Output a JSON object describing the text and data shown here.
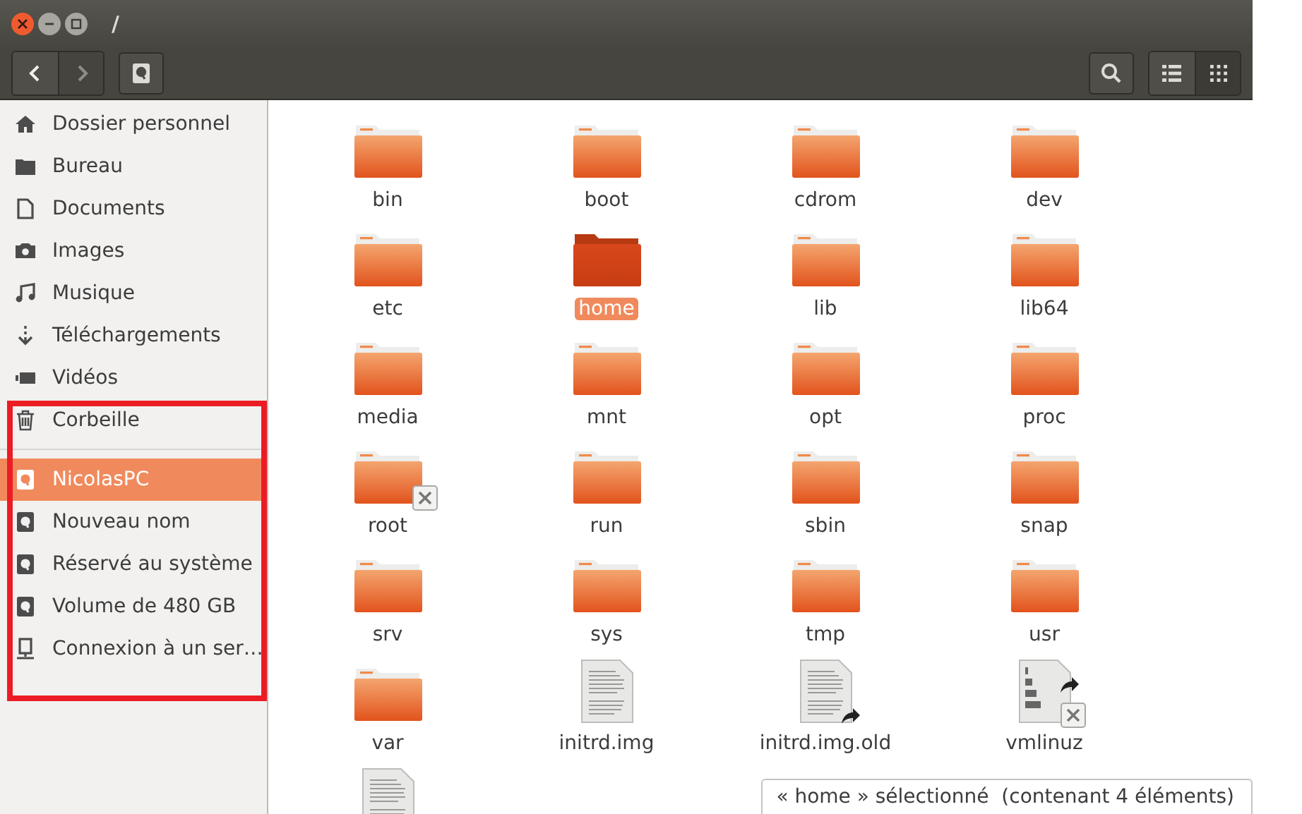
{
  "window": {
    "title": "/"
  },
  "toolbar": {
    "back_disabled": false,
    "forward_disabled": true,
    "view_buttons": [
      {
        "kind": "list",
        "selected": false
      },
      {
        "kind": "grid",
        "selected": true
      }
    ]
  },
  "sidebar": {
    "sections": [
      {
        "items": [
          {
            "label": "Dossier personnel",
            "kind": "home",
            "selected": false
          },
          {
            "label": "Bureau",
            "kind": "folder",
            "selected": false
          },
          {
            "label": "Documents",
            "kind": "document",
            "selected": false
          },
          {
            "label": "Images",
            "kind": "camera",
            "selected": false
          },
          {
            "label": "Musique",
            "kind": "music",
            "selected": false
          },
          {
            "label": "Téléchargements",
            "kind": "download",
            "selected": false
          },
          {
            "label": "Vidéos",
            "kind": "video",
            "selected": false
          },
          {
            "label": "Corbeille",
            "kind": "trash",
            "selected": false
          }
        ]
      },
      {
        "items": [
          {
            "label": "NicolasPC",
            "kind": "drive",
            "selected": true
          },
          {
            "label": "Nouveau nom",
            "kind": "drive",
            "selected": false
          },
          {
            "label": "Réservé au système",
            "kind": "drive",
            "selected": false
          },
          {
            "label": "Volume de 480 GB",
            "kind": "drive",
            "selected": false
          },
          {
            "label": "Connexion à un ser…",
            "kind": "network",
            "selected": false
          }
        ]
      }
    ]
  },
  "files": [
    {
      "name": "bin",
      "kind": "folder",
      "selected": false
    },
    {
      "name": "boot",
      "kind": "folder",
      "selected": false
    },
    {
      "name": "cdrom",
      "kind": "folder",
      "selected": false
    },
    {
      "name": "dev",
      "kind": "folder",
      "selected": false
    },
    {
      "name": "etc",
      "kind": "folder",
      "selected": false
    },
    {
      "name": "home",
      "kind": "folder",
      "selected": true
    },
    {
      "name": "lib",
      "kind": "folder",
      "selected": false
    },
    {
      "name": "lib64",
      "kind": "folder",
      "selected": false
    },
    {
      "name": "media",
      "kind": "folder",
      "selected": false
    },
    {
      "name": "mnt",
      "kind": "folder",
      "selected": false
    },
    {
      "name": "opt",
      "kind": "folder",
      "selected": false
    },
    {
      "name": "proc",
      "kind": "folder",
      "selected": false
    },
    {
      "name": "root",
      "kind": "folder",
      "selected": false,
      "unreadable": true
    },
    {
      "name": "run",
      "kind": "folder",
      "selected": false
    },
    {
      "name": "sbin",
      "kind": "folder",
      "selected": false
    },
    {
      "name": "snap",
      "kind": "folder",
      "selected": false
    },
    {
      "name": "srv",
      "kind": "folder",
      "selected": false
    },
    {
      "name": "sys",
      "kind": "folder",
      "selected": false
    },
    {
      "name": "tmp",
      "kind": "folder",
      "selected": false
    },
    {
      "name": "usr",
      "kind": "folder",
      "selected": false
    },
    {
      "name": "var",
      "kind": "folder",
      "selected": false
    },
    {
      "name": "initrd.img",
      "kind": "text",
      "selected": false
    },
    {
      "name": "initrd.img.old",
      "kind": "text",
      "selected": false,
      "link": true
    },
    {
      "name": "vmlinuz",
      "kind": "binary",
      "selected": false,
      "link": true,
      "unreadable": true
    },
    {
      "kind": "text",
      "selected": false
    }
  ],
  "status_bar": "« home » sélectionné  (contenant 4 éléments)"
}
